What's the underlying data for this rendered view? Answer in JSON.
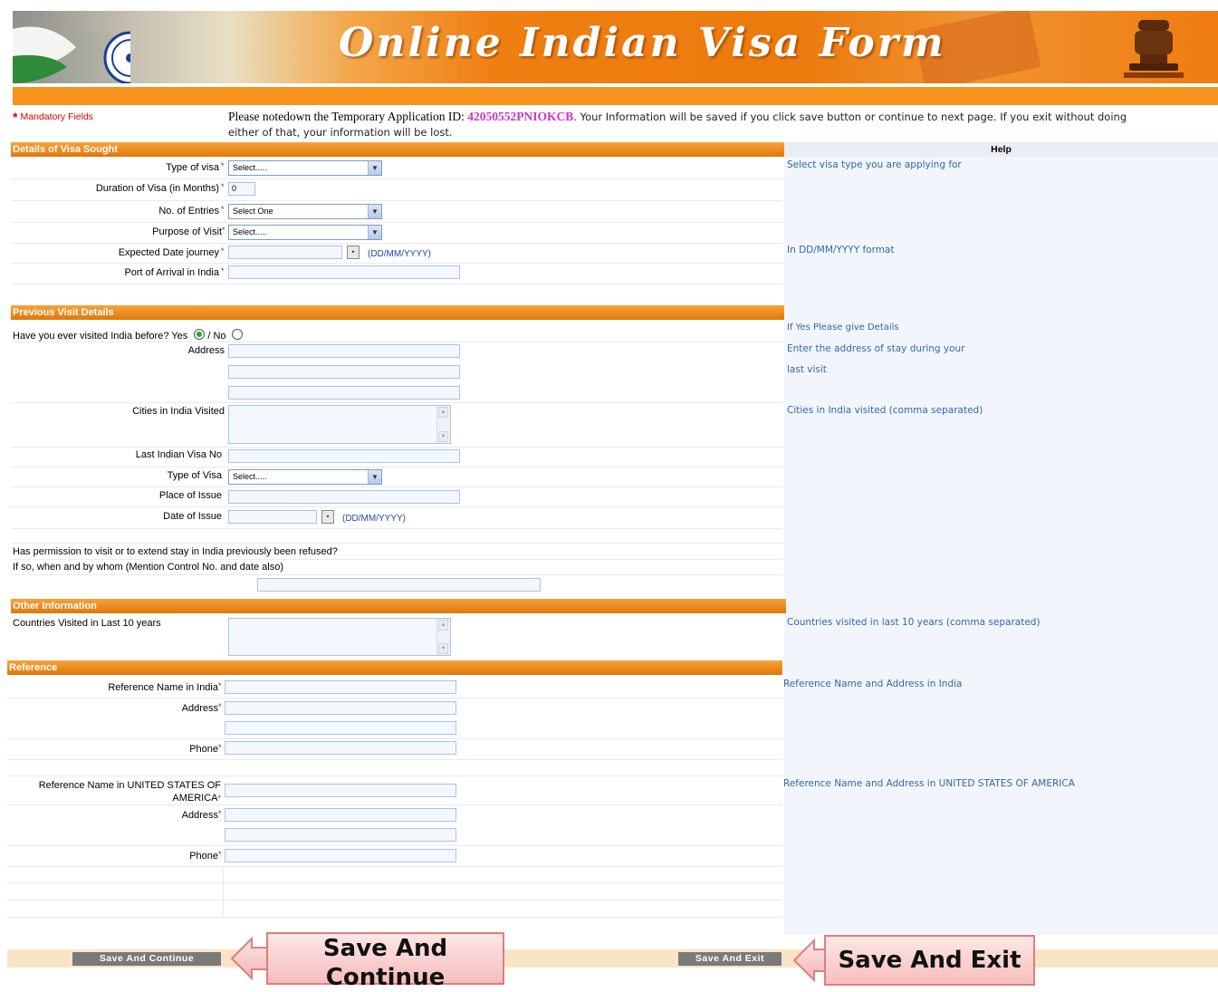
{
  "banner": {
    "title": "Online Indian Visa Form"
  },
  "header": {
    "mandatory_star": "*",
    "mandatory_label": "Mandatory Fields",
    "notice_prefix": "Please notedown the Temporary Application ID: ",
    "application_id": "42050552PNIOKCB",
    "notice_suffix": ". Your Information will be saved if you click save button or continue to next page. If you exit without doing",
    "notice_line2": "either of that, your information will be lost."
  },
  "help_header": "Help",
  "visa_section": {
    "title": "Details of Visa Sought",
    "type_of_visa_label": "Type of visa",
    "type_of_visa_value": "Select.....",
    "duration_label": "Duration of Visa (in Months)",
    "duration_value": "0",
    "entries_label": "No. of Entries",
    "entries_value": "Select One",
    "purpose_label": "Purpose of Visit",
    "purpose_value": "Select.....",
    "journey_label": "Expected Date journey",
    "journey_format": "(DD/MM/YYYY)",
    "port_label": "Port of Arrival in India",
    "help_visa_type": "Select visa type you are applying for",
    "help_date": "In DD/MM/YYYY format"
  },
  "previous_section": {
    "title": "Previous Visit Details",
    "visited_question": "Have you ever visited India before? Yes",
    "no_label": "/ No",
    "address_label": "Address",
    "cities_label": "Cities in India Visited",
    "last_visa_label": "Last Indian Visa No",
    "type_visa_label": "Type of Visa",
    "type_visa_value": "Select.....",
    "place_issue_label": "Place of Issue",
    "date_issue_label": "Date of Issue",
    "date_issue_format": "(DD/MM/YYYY)",
    "refused_question": "Has permission to visit or to extend stay in India previously been refused?",
    "refused_detail": "If so, when and by whom (Mention Control No. and date also)",
    "help_yes": "If Yes Please give Details",
    "help_address_1": "Enter the address of stay during your",
    "help_address_2": "last visit",
    "help_cities": "Cities in India visited (comma separated)"
  },
  "other_section": {
    "title": "Other Information",
    "countries_label": "Countries Visited in Last 10 years",
    "help_countries": "Countries visited in last 10 years (comma separated)"
  },
  "reference_section": {
    "title": "Reference",
    "india_name_label": "Reference Name in India",
    "india_address_label": "Address",
    "india_phone_label": "Phone",
    "usa_name_label_1": "Reference Name in UNITED STATES OF",
    "usa_name_label_2": "AMERICA",
    "usa_address_label": "Address",
    "usa_phone_label": "Phone",
    "help_india": "Reference Name and Address in India",
    "help_usa": "Reference Name and Address in UNITED STATES OF AMERICA"
  },
  "buttons": {
    "save_continue": "Save And Continue",
    "save_exit": "Save And Exit"
  },
  "callouts": {
    "continue_line1": "Save And",
    "continue_line2": "Continue",
    "exit": "Save And Exit"
  },
  "colors": {
    "accent": "#f7941d",
    "help_text": "#3366aa",
    "app_id": "#cc33cc",
    "mandatory": "#dd0000"
  }
}
